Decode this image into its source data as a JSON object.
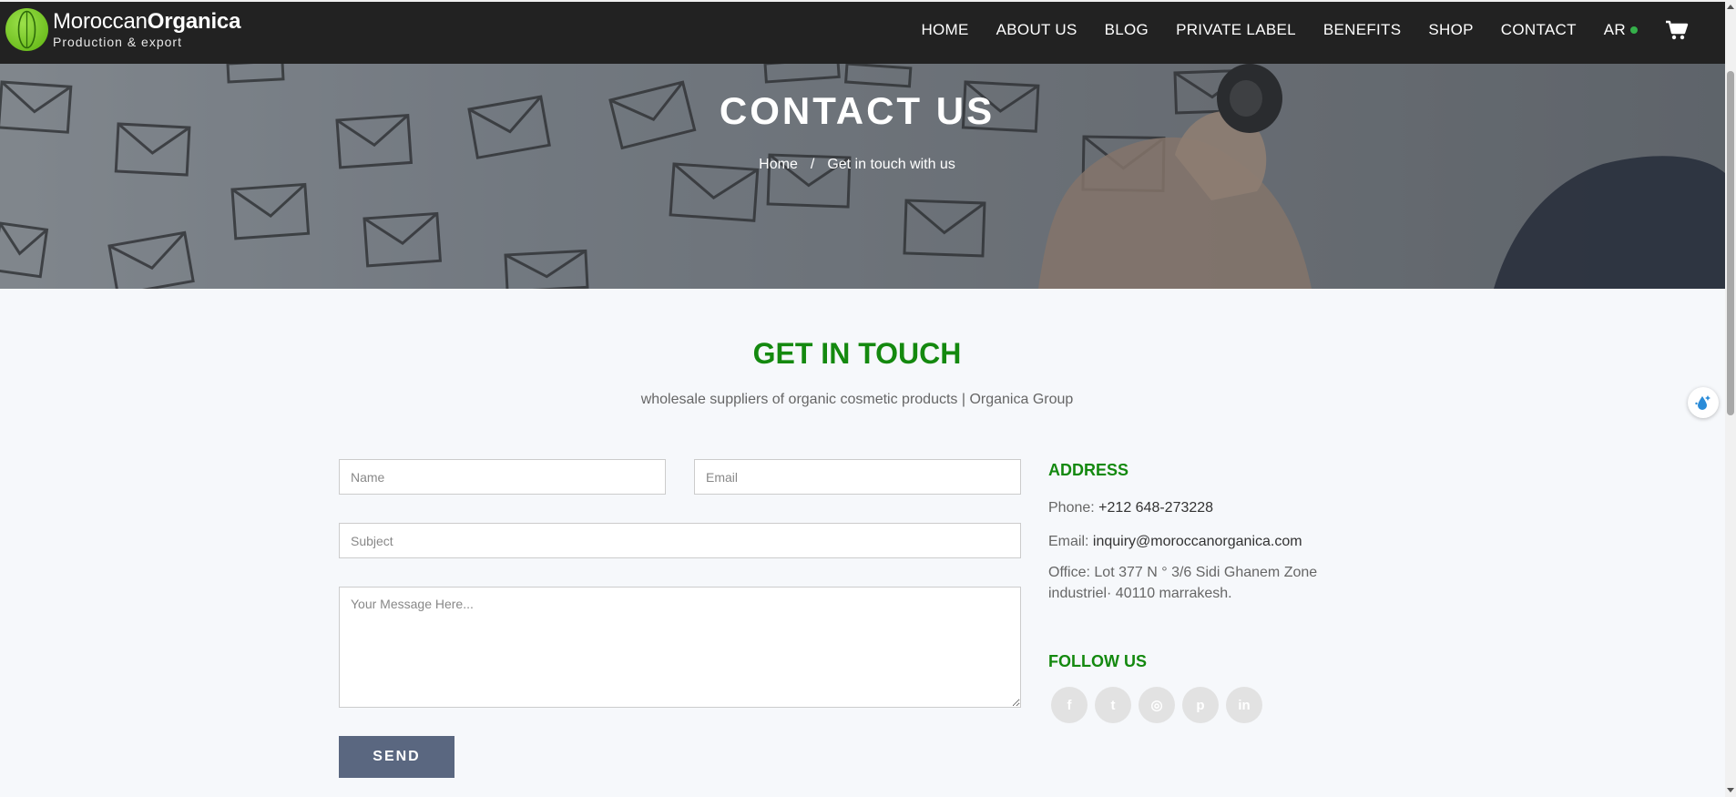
{
  "header": {
    "logo_main": "Moroccan",
    "logo_bold": "Organica",
    "logo_sub": "Production & export",
    "nav": [
      "HOME",
      "ABOUT US",
      "BLOG",
      "PRIVATE LABEL",
      "BENEFITS",
      "SHOP",
      "CONTACT"
    ],
    "lang": "AR",
    "lang_dot_color": "#35b04a",
    "cart_icon": "cart-icon"
  },
  "hero": {
    "title": "CONTACT US",
    "breadcrumb": {
      "home": "Home",
      "separator": "/",
      "current": "Get in touch with us"
    }
  },
  "section": {
    "title": "GET IN TOUCH",
    "subtitle": "wholesale suppliers of organic cosmetic products | Organica Group"
  },
  "form": {
    "name_placeholder": "Name",
    "email_placeholder": "Email",
    "subject_placeholder": "Subject",
    "message_placeholder": "Your Message Here...",
    "send_label": "SEND"
  },
  "contact": {
    "address_heading": "ADDRESS",
    "phone_label": "Phone:",
    "phone_value": "+212 648-273228",
    "email_label": "Email:",
    "email_value": "inquiry@moroccanorganica.com",
    "office_label": "Office:",
    "office_line1": "Lot 377 N ° 3/6 Sidi Ghanem Zone",
    "office_line2": "industriel· 40110 marrakesh.",
    "follow_heading": "FOLLOW US",
    "socials": [
      "facebook-icon",
      "twitter-icon",
      "instagram-icon",
      "pinterest-icon",
      "linkedin-icon"
    ],
    "social_glyphs": [
      "f",
      "t",
      "◎",
      "p",
      "in"
    ]
  },
  "colors": {
    "accent_green": "#14890f",
    "header_bg": "#222222",
    "send_bg": "#5a6780",
    "page_bg": "#f6f8fb"
  }
}
